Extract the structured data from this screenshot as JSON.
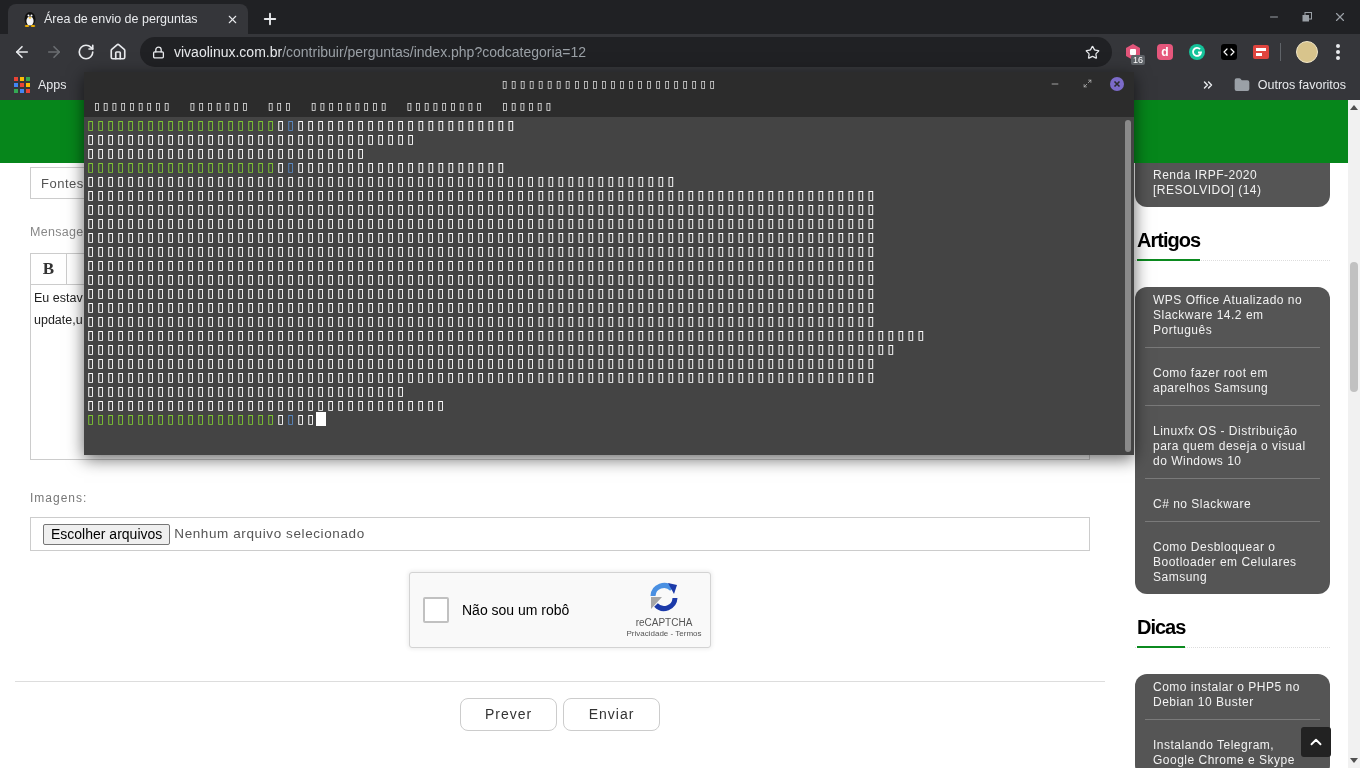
{
  "browser": {
    "tabs": [
      {
        "title": "Área de envio de perguntas",
        "selected": true
      }
    ],
    "nav_buttons": [
      {
        "kind": "back",
        "disabled": false
      },
      {
        "kind": "forward",
        "disabled": true
      },
      {
        "kind": "reload",
        "disabled": false
      },
      {
        "kind": "home",
        "disabled": false
      }
    ],
    "address_bar": {
      "domain": "vivaolinux.com.br",
      "path": "/contribuir/perguntas/index.php?codcategoria=12"
    },
    "extensions": [
      {
        "kind": "hexagon",
        "badge": "16"
      },
      {
        "kind": "letter",
        "text": "d"
      },
      {
        "kind": "ring"
      },
      {
        "kind": "code"
      },
      {
        "kind": "tile"
      }
    ],
    "bookmarks_bar": {
      "apps": "Apps",
      "other_bookmarks": "Outros favoritos"
    }
  },
  "page": {
    "sources_field": {
      "placeholder": "Fontes"
    },
    "message_label": "Mensage",
    "editor_toolbar": [
      {
        "label": "B"
      }
    ],
    "message_field": {
      "lines": [
        "Eu estav",
        "update,u"
      ]
    },
    "images_label": "Imagens:",
    "file_input": {
      "button": "Escolher arquivos",
      "status": "Nenhum arquivo selecionado"
    },
    "captcha": {
      "label": "Não sou um robô",
      "checked": false,
      "brand": "reCAPTCHA",
      "links": "Privacidade - Termos"
    },
    "buttons": [
      "Prever",
      "Enviar"
    ]
  },
  "sidebar": {
    "sections": [
      {
        "items": [
          "Renda IRPF-2020 [RESOLVIDO] (14)"
        ]
      },
      {
        "heading": "Artigos",
        "items": [
          "WPS Office Atualizado no Slackware 14.2 em Português",
          "Como fazer root em aparelhos Samsung",
          "Linuxfx OS - Distribuição para quem deseja o visual do Windows 10",
          "C# no Slackware",
          "Como Desbloquear o Bootloader em Celulares Samsung"
        ]
      },
      {
        "heading": "Dicas",
        "items": [
          "Como instalar o PHP5 no Debian 10 Buster",
          "Instalando Telegram, Google Chrome e Skype"
        ]
      }
    ]
  },
  "terminal": {
    "title": "▯▯▯▯▯▯▯▯▯▯▯▯▯▯▯▯▯▯▯▯▯▯▯▯",
    "menus": [
      "▯▯▯▯▯▯▯▯▯",
      "▯▯▯▯▯▯▯",
      "▯▯▯",
      "▯▯▯▯▯▯▯▯▯",
      "▯▯▯▯▯▯▯▯▯",
      "▯▯▯▯▯▯"
    ],
    "lines": [
      {
        "segments": [
          {
            "kind": "user",
            "text": "▯▯▯▯▯▯▯▯▯▯▯▯▯▯▯▯▯▯▯"
          },
          {
            "kind": "plain",
            "text": "▯"
          },
          {
            "kind": "path",
            "text": "▯"
          },
          {
            "kind": "plain",
            "text": "▯▯▯▯▯▯▯▯▯▯▯▯▯▯▯▯▯▯▯▯▯▯"
          }
        ],
        "cursor": false
      },
      {
        "segments": [
          {
            "kind": "plain",
            "text": "▯▯▯▯▯▯▯▯▯▯▯▯▯▯▯▯▯▯▯▯▯▯▯▯▯▯▯▯▯▯▯▯▯"
          }
        ],
        "cursor": false
      },
      {
        "segments": [
          {
            "kind": "plain",
            "text": "▯▯▯▯▯▯▯▯▯▯▯▯▯▯▯▯▯▯▯▯▯▯▯▯▯▯▯▯"
          }
        ],
        "cursor": false
      },
      {
        "segments": [
          {
            "kind": "user",
            "text": "▯▯▯▯▯▯▯▯▯▯▯▯▯▯▯▯▯▯▯"
          },
          {
            "kind": "plain",
            "text": "▯"
          },
          {
            "kind": "path",
            "text": "▯"
          },
          {
            "kind": "plain",
            "text": "▯▯▯▯▯▯▯▯▯▯▯▯▯▯▯▯▯▯▯▯▯"
          }
        ],
        "cursor": false
      },
      {
        "segments": [
          {
            "kind": "plain",
            "text": "▯▯▯▯▯▯▯▯▯▯▯▯▯▯▯▯▯▯▯▯▯▯▯▯▯▯▯▯▯▯▯▯▯▯▯▯▯▯▯▯▯▯▯▯▯▯▯▯▯▯▯▯▯▯▯▯▯▯▯"
          }
        ],
        "cursor": false
      },
      {
        "segments": [
          {
            "kind": "plain",
            "text": "▯▯▯▯▯▯▯▯▯▯▯▯▯▯▯▯▯▯▯▯▯▯▯▯▯▯▯▯▯▯▯▯▯▯▯▯▯▯▯▯▯▯▯▯▯▯▯▯▯▯▯▯▯▯▯▯▯▯▯▯▯▯▯▯▯▯▯▯▯▯▯▯▯▯▯▯▯▯▯"
          }
        ],
        "cursor": false
      },
      {
        "segments": [
          {
            "kind": "plain",
            "text": "▯▯▯▯▯▯▯▯▯▯▯▯▯▯▯▯▯▯▯▯▯▯▯▯▯▯▯▯▯▯▯▯▯▯▯▯▯▯▯▯▯▯▯▯▯▯▯▯▯▯▯▯▯▯▯▯▯▯▯▯▯▯▯▯▯▯▯▯▯▯▯▯▯▯▯▯▯▯▯"
          }
        ],
        "cursor": false
      },
      {
        "segments": [
          {
            "kind": "plain",
            "text": "▯▯▯▯▯▯▯▯▯▯▯▯▯▯▯▯▯▯▯▯▯▯▯▯▯▯▯▯▯▯▯▯▯▯▯▯▯▯▯▯▯▯▯▯▯▯▯▯▯▯▯▯▯▯▯▯▯▯▯▯▯▯▯▯▯▯▯▯▯▯▯▯▯▯▯▯▯▯▯"
          }
        ],
        "cursor": false
      },
      {
        "segments": [
          {
            "kind": "plain",
            "text": "▯▯▯▯▯▯▯▯▯▯▯▯▯▯▯▯▯▯▯▯▯▯▯▯▯▯▯▯▯▯▯▯▯▯▯▯▯▯▯▯▯▯▯▯▯▯▯▯▯▯▯▯▯▯▯▯▯▯▯▯▯▯▯▯▯▯▯▯▯▯▯▯▯▯▯▯▯▯▯"
          }
        ],
        "cursor": false
      },
      {
        "segments": [
          {
            "kind": "plain",
            "text": "▯▯▯▯▯▯▯▯▯▯▯▯▯▯▯▯▯▯▯▯▯▯▯▯▯▯▯▯▯▯▯▯▯▯▯▯▯▯▯▯▯▯▯▯▯▯▯▯▯▯▯▯▯▯▯▯▯▯▯▯▯▯▯▯▯▯▯▯▯▯▯▯▯▯▯▯▯▯▯"
          }
        ],
        "cursor": false
      },
      {
        "segments": [
          {
            "kind": "plain",
            "text": "▯▯▯▯▯▯▯▯▯▯▯▯▯▯▯▯▯▯▯▯▯▯▯▯▯▯▯▯▯▯▯▯▯▯▯▯▯▯▯▯▯▯▯▯▯▯▯▯▯▯▯▯▯▯▯▯▯▯▯▯▯▯▯▯▯▯▯▯▯▯▯▯▯▯▯▯▯▯▯"
          }
        ],
        "cursor": false
      },
      {
        "segments": [
          {
            "kind": "plain",
            "text": "▯▯▯▯▯▯▯▯▯▯▯▯▯▯▯▯▯▯▯▯▯▯▯▯▯▯▯▯▯▯▯▯▯▯▯▯▯▯▯▯▯▯▯▯▯▯▯▯▯▯▯▯▯▯▯▯▯▯▯▯▯▯▯▯▯▯▯▯▯▯▯▯▯▯▯▯▯▯▯"
          }
        ],
        "cursor": false
      },
      {
        "segments": [
          {
            "kind": "plain",
            "text": "▯▯▯▯▯▯▯▯▯▯▯▯▯▯▯▯▯▯▯▯▯▯▯▯▯▯▯▯▯▯▯▯▯▯▯▯▯▯▯▯▯▯▯▯▯▯▯▯▯▯▯▯▯▯▯▯▯▯▯▯▯▯▯▯▯▯▯▯▯▯▯▯▯▯▯▯▯▯▯"
          }
        ],
        "cursor": false
      },
      {
        "segments": [
          {
            "kind": "plain",
            "text": "▯▯▯▯▯▯▯▯▯▯▯▯▯▯▯▯▯▯▯▯▯▯▯▯▯▯▯▯▯▯▯▯▯▯▯▯▯▯▯▯▯▯▯▯▯▯▯▯▯▯▯▯▯▯▯▯▯▯▯▯▯▯▯▯▯▯▯▯▯▯▯▯▯▯▯▯▯▯▯"
          }
        ],
        "cursor": false
      },
      {
        "segments": [
          {
            "kind": "plain",
            "text": "▯▯▯▯▯▯▯▯▯▯▯▯▯▯▯▯▯▯▯▯▯▯▯▯▯▯▯▯▯▯▯▯▯▯▯▯▯▯▯▯▯▯▯▯▯▯▯▯▯▯▯▯▯▯▯▯▯▯▯▯▯▯▯▯▯▯▯▯▯▯▯▯▯▯▯▯▯▯▯"
          }
        ],
        "cursor": false
      },
      {
        "segments": [
          {
            "kind": "plain",
            "text": "▯▯▯▯▯▯▯▯▯▯▯▯▯▯▯▯▯▯▯▯▯▯▯▯▯▯▯▯▯▯▯▯▯▯▯▯▯▯▯▯▯▯▯▯▯▯▯▯▯▯▯▯▯▯▯▯▯▯▯▯▯▯▯▯▯▯▯▯▯▯▯▯▯▯▯▯▯▯▯▯▯▯▯▯"
          }
        ],
        "cursor": false
      },
      {
        "segments": [
          {
            "kind": "plain",
            "text": "▯▯▯▯▯▯▯▯▯▯▯▯▯▯▯▯▯▯▯▯▯▯▯▯▯▯▯▯▯▯▯▯▯▯▯▯▯▯▯▯▯▯▯▯▯▯▯▯▯▯▯▯▯▯▯▯▯▯▯▯▯▯▯▯▯▯▯▯▯▯▯▯▯▯▯▯▯▯▯▯▯"
          }
        ],
        "cursor": false
      },
      {
        "segments": [
          {
            "kind": "plain",
            "text": "▯▯▯▯▯▯▯▯▯▯▯▯▯▯▯▯▯▯▯▯▯▯▯▯▯▯▯▯▯▯▯▯▯▯▯▯▯▯▯▯▯▯▯▯▯▯▯▯▯▯▯▯▯▯▯▯▯▯▯▯▯▯▯▯▯▯▯▯▯▯▯▯▯▯▯▯▯▯▯"
          }
        ],
        "cursor": false
      },
      {
        "segments": [
          {
            "kind": "plain",
            "text": "▯▯▯▯▯▯▯▯▯▯▯▯▯▯▯▯▯▯▯▯▯▯▯▯▯▯▯▯▯▯▯▯▯▯▯▯▯▯▯▯▯▯▯▯▯▯▯▯▯▯▯▯▯▯▯▯▯▯▯▯▯▯▯▯▯▯▯▯▯▯▯▯▯▯▯▯▯▯▯"
          }
        ],
        "cursor": false
      },
      {
        "segments": [
          {
            "kind": "plain",
            "text": "▯▯▯▯▯▯▯▯▯▯▯▯▯▯▯▯▯▯▯▯▯▯▯▯▯▯▯▯▯▯▯▯"
          }
        ],
        "cursor": false
      },
      {
        "segments": [
          {
            "kind": "plain",
            "text": "▯▯▯▯▯▯▯▯▯▯▯▯▯▯▯▯▯▯▯▯▯▯▯▯▯▯▯▯▯▯▯▯▯▯▯▯"
          }
        ],
        "cursor": false
      },
      {
        "segments": [
          {
            "kind": "user",
            "text": "▯▯▯▯▯▯▯▯▯▯▯▯▯▯▯▯▯▯▯"
          },
          {
            "kind": "plain",
            "text": "▯"
          },
          {
            "kind": "path",
            "text": "▯"
          },
          {
            "kind": "plain",
            "text": "▯▯"
          }
        ],
        "cursor": true
      }
    ]
  }
}
